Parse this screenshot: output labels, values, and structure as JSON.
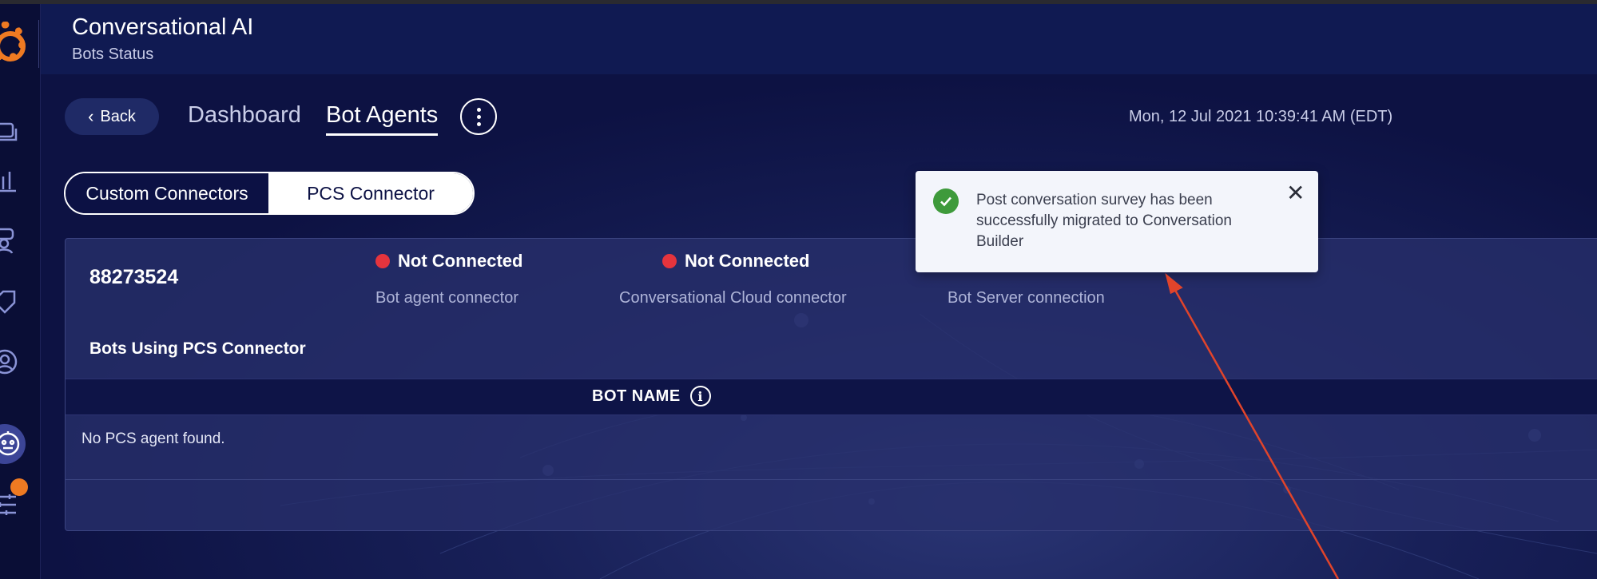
{
  "header": {
    "title": "Conversational AI",
    "subtitle": "Bots Status"
  },
  "nav": {
    "back_label": "Back",
    "tabs": [
      {
        "label": "Dashboard",
        "active": false
      },
      {
        "label": "Bot Agents",
        "active": true
      }
    ],
    "more_icon": "more-vertical-icon",
    "timestamp": "Mon, 12 Jul 2021 10:39:41 AM (EDT)"
  },
  "segmented": {
    "options": [
      {
        "label": "Custom Connectors",
        "selected": false
      },
      {
        "label": "PCS Connector",
        "selected": true
      }
    ]
  },
  "panel": {
    "account_id": "88273524",
    "connections": [
      {
        "status": "Not Connected",
        "label": "Bot agent connector",
        "status_color": "#e5343d"
      },
      {
        "status": "Not Connected",
        "label": "Conversational Cloud connector",
        "status_color": "#e5343d"
      },
      {
        "label": "Bot Server connection"
      }
    ],
    "section_title": "Bots Using PCS Connector",
    "table": {
      "columns": [
        "BOT NAME"
      ],
      "empty_message": "No PCS agent found."
    }
  },
  "toast": {
    "message": "Post conversation survey has been successfully migrated to Conversation Builder",
    "icon": "check-circle-icon",
    "close_icon": "close-icon"
  },
  "colors": {
    "accent": "#ef7a22",
    "error": "#e5343d",
    "success": "#3e9a3b",
    "background": "#0b0f3a",
    "annotation_arrow": "#e0442b"
  },
  "sidebar": {
    "icons": [
      "conversations-icon",
      "analytics-icon",
      "agents-icon",
      "tag-icon",
      "user-search-icon",
      "bot-icon",
      "settings-sliders-icon"
    ]
  }
}
